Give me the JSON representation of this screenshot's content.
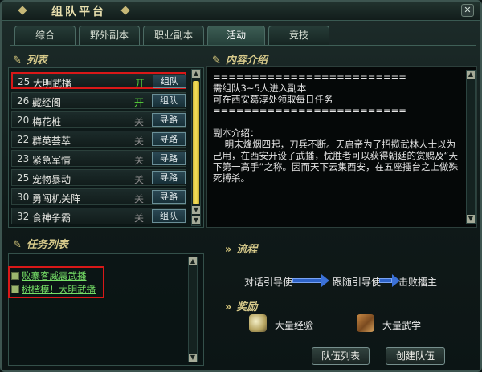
{
  "window": {
    "title": "组队平台"
  },
  "tabs": [
    {
      "label": "综合"
    },
    {
      "label": "野外副本"
    },
    {
      "label": "职业副本"
    },
    {
      "label": "活动"
    },
    {
      "label": "竞技"
    }
  ],
  "list": {
    "heading": "列表",
    "rows": [
      {
        "level": "25",
        "name": "大明武播",
        "status": "开",
        "button": "组队"
      },
      {
        "level": "26",
        "name": "藏经阁",
        "status": "开",
        "button": "组队"
      },
      {
        "level": "20",
        "name": "梅花桩",
        "status": "关",
        "button": "寻路"
      },
      {
        "level": "22",
        "name": "群英荟萃",
        "status": "关",
        "button": "寻路"
      },
      {
        "level": "23",
        "name": "紧急军情",
        "status": "关",
        "button": "寻路"
      },
      {
        "level": "25",
        "name": "宠物暴动",
        "status": "关",
        "button": "寻路"
      },
      {
        "level": "30",
        "name": "勇闯机关阵",
        "status": "关",
        "button": "寻路"
      },
      {
        "level": "32",
        "name": "食神争霸",
        "status": "关",
        "button": "组队"
      }
    ]
  },
  "quests": {
    "heading": "任务列表",
    "items": [
      {
        "label": "败寨客威震武播"
      },
      {
        "label": "树楷模！大明武播"
      }
    ]
  },
  "content": {
    "heading": "内容介绍",
    "lines": [
      "=========================",
      "需组队3~5人进入副本",
      "可在西安葛淳处领取每日任务",
      "=========================",
      "",
      "副本介绍：",
      "    明末烽烟四起，刀兵不断。天启帝为了招揽武林人士以为己用，在西安开设了武播，忧胜者可以获得朝廷的赏赐及“天下第一高手”之称。因而天下云集西安，在五座擂台之上做殊死搏杀。"
    ]
  },
  "flow": {
    "heading": "流程",
    "steps": [
      "对话引导使",
      "跟随引导使",
      "击败擂主"
    ]
  },
  "rewards": {
    "heading": "奖励",
    "items": [
      {
        "label": "大量经验",
        "icon": "experience-orb-icon"
      },
      {
        "label": "大量武学",
        "icon": "martial-arts-scroll-icon"
      }
    ]
  },
  "buttons": {
    "team_list": "队伍列表",
    "create_team": "创建队伍"
  },
  "colors": {
    "accent_gold": "#d6c98a",
    "open_green": "#58d43b",
    "closed_gray": "#8a8a8a",
    "quest_green": "#76e067",
    "highlight_red": "#d91818"
  }
}
